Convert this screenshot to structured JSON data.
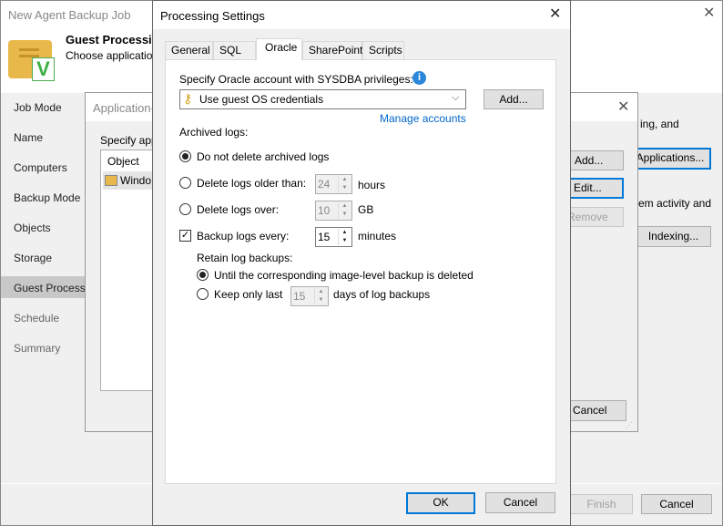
{
  "main": {
    "title": "New Agent Backup Job",
    "header_title": "Guest Processing",
    "header_subtitle": "Choose application",
    "nav": [
      "Job Mode",
      "Name",
      "Computers",
      "Backup Mode",
      "Objects",
      "Storage",
      "Guest Processing",
      "Schedule",
      "Summary"
    ],
    "selected_nav": "Guest Processing",
    "right_text1": "ing, and",
    "applications_button": "Applications...",
    "right_text2": "em activity and",
    "indexing_button": "Indexing...",
    "finish_button": "Finish",
    "cancel_button": "Cancel"
  },
  "app_dialog": {
    "title": "Application-",
    "specify_label": "Specify app",
    "column_object": "Object",
    "row1": "Windo",
    "add_button": "Add...",
    "edit_button": "Edit...",
    "remove_button": "Remove",
    "cancel_button": "Cancel"
  },
  "processing": {
    "title": "Processing Settings",
    "tabs": [
      "General",
      "SQL",
      "Oracle",
      "SharePoint",
      "Scripts"
    ],
    "active_tab": "Oracle",
    "account_label": "Specify Oracle account with SYSDBA privileges:",
    "account_value": "Use guest OS credentials",
    "add_button": "Add...",
    "manage_accounts": "Manage accounts",
    "archived_logs_label": "Archived logs:",
    "opt_no_delete": "Do not delete archived logs",
    "opt_older": "Delete logs older than:",
    "older_value": "24",
    "older_unit": "hours",
    "opt_over": "Delete logs over:",
    "over_value": "10",
    "over_unit": "GB",
    "backup_logs": "Backup logs every:",
    "backup_checked": true,
    "backup_value": "15",
    "backup_unit": "minutes",
    "retain_label": "Retain log backups:",
    "retain_until": "Until the corresponding image-level backup is deleted",
    "retain_keep": "Keep only last",
    "keep_value": "15",
    "keep_unit": "days of log backups",
    "ok_button": "OK",
    "cancel_button": "Cancel"
  }
}
